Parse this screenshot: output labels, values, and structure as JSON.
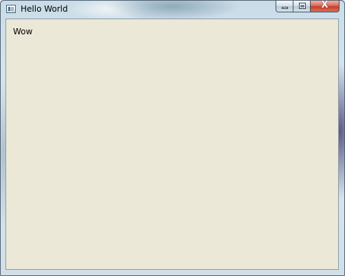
{
  "window": {
    "title": "Hello World",
    "icon": "app-window-icon"
  },
  "caption_buttons": {
    "minimize_icon": "minimize-icon",
    "maximize_icon": "maximize-icon",
    "close_icon": "close-icon",
    "close_glyph": "X"
  },
  "content": {
    "label": "Wow"
  },
  "colors": {
    "client_background": "#ece8d8",
    "close_button": "#c23f2a"
  }
}
